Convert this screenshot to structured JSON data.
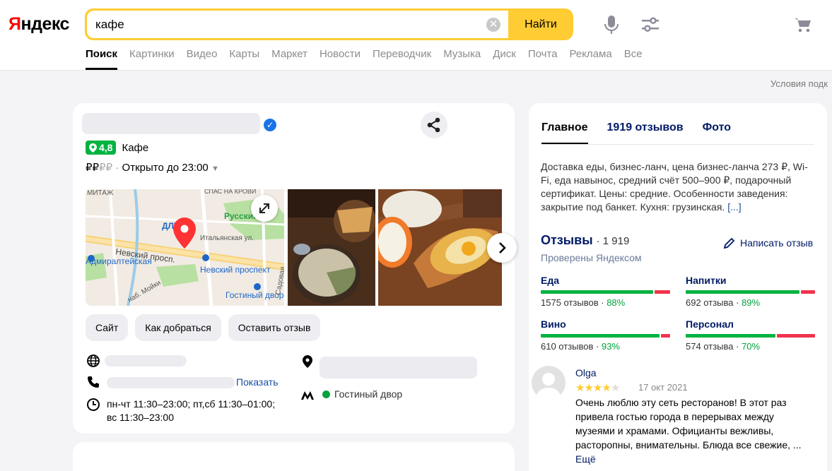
{
  "header": {
    "logo_first": "Я",
    "logo_rest": "ндекс",
    "search_value": "кафе",
    "search_button": "Найти",
    "conditions_link": "Условия подк"
  },
  "nav": {
    "tabs": [
      "Поиск",
      "Картинки",
      "Видео",
      "Карты",
      "Маркет",
      "Новости",
      "Переводчик",
      "Музыка",
      "Диск",
      "Почта",
      "Реклама",
      "Все"
    ],
    "active_index": 0
  },
  "business": {
    "rating": "4,8",
    "category": "Кафе",
    "price_level_on": "₽₽",
    "price_level_off": "₽₽",
    "separator": "·",
    "hours_status": "Открыто до 23:00",
    "actions": [
      "Сайт",
      "Как добраться",
      "Оставить отзыв"
    ],
    "show_phone": "Показать",
    "hours": "пн-чт 11:30–23:00; пт,сб 11:30–01:00; вс 11:30–23:00",
    "metro": "Гостиный двор",
    "map_labels": {
      "street1": "МИТАЖ",
      "street2": "СПАС НА КРОВИ",
      "street3": "Русский",
      "street4": "ДЛТ",
      "street5": "Итальянская ул.",
      "street6": "Невский просп.",
      "metro1": "Адмиралтейская",
      "metro2": "Невский проспект",
      "metro3": "Гостиный двор",
      "street7": "наб. Мойки",
      "street8": "Садовая"
    }
  },
  "right": {
    "tabs": [
      "Главное",
      "1919 отзывов",
      "Фото"
    ],
    "description": "Доставка еды, бизнес-ланч, цена бизнес-ланча 273 ₽, Wi-Fi, еда навынос, средний счёт 500–900 ₽, подарочный сертификат. Цены: средние. Особенности заведения: закрытие под банкет. Кухня: грузинская.",
    "description_more": "[...]",
    "reviews_title": "Отзывы",
    "reviews_count": "· 1 919",
    "write_review": "Написать отзыв",
    "verified": "Проверены Яндексом",
    "aspects": [
      {
        "name": "Еда",
        "count": "1575 отзывов",
        "pct": "88%",
        "fraction": 0.88
      },
      {
        "name": "Напитки",
        "count": "692 отзыва",
        "pct": "89%",
        "fraction": 0.89
      },
      {
        "name": "Вино",
        "count": "610 отзывов",
        "pct": "93%",
        "fraction": 0.93
      },
      {
        "name": "Персонал",
        "count": "574 отзыва",
        "pct": "70%",
        "fraction": 0.7
      }
    ],
    "stat_sep": " · ",
    "review": {
      "author": "Olga",
      "rating": 4,
      "date": "17 окт 2021",
      "text": "Очень люблю эту сеть ресторанов! В этот раз привела гостью города в перерывах между музеями и храмами. Официанты вежливы, расторопны, внимательны. Блюда все свежие, ...",
      "more": "Ещё"
    }
  },
  "colors": {
    "yandex_yellow": "#ffcc33",
    "rating_green": "#00b341",
    "negative_red": "#f1334d",
    "link_blue": "#001a66"
  }
}
